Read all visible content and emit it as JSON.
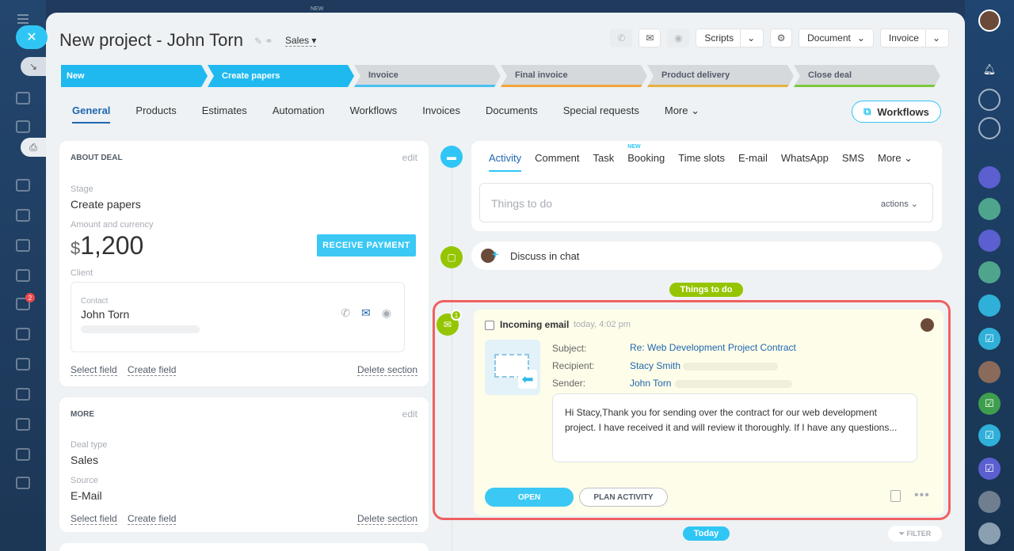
{
  "header": {
    "title": "New project - John Torn",
    "category": "Sales",
    "scripts_label": "Scripts",
    "document_label": "Document",
    "invoice_label": "Invoice"
  },
  "stages": [
    {
      "label": "New",
      "state": "on",
      "color": "#1fb9ef"
    },
    {
      "label": "Create papers",
      "state": "on",
      "color": "#1fb9ef"
    },
    {
      "label": "Invoice",
      "state": "off",
      "color": "#47c1f0"
    },
    {
      "label": "Final invoice",
      "state": "off",
      "color": "#f3a53a"
    },
    {
      "label": "Product delivery",
      "state": "off",
      "color": "#e6b13e"
    },
    {
      "label": "Close deal",
      "state": "off",
      "color": "#7cc83e"
    }
  ],
  "tabs": [
    "General",
    "Products",
    "Estimates",
    "Automation",
    "Workflows",
    "Invoices",
    "Documents",
    "Special requests",
    "More"
  ],
  "workflows_button": "Workflows",
  "about": {
    "heading": "ABOUT DEAL",
    "edit": "edit",
    "stage_label": "Stage",
    "stage_value": "Create papers",
    "amount_label": "Amount and currency",
    "currency": "$",
    "amount": "1,200",
    "pay_button": "RECEIVE PAYMENT",
    "client_label": "Client",
    "contact_label": "Contact",
    "contact_name": "John Torn",
    "select_field": "Select field",
    "create_field": "Create field",
    "delete_section": "Delete section"
  },
  "more": {
    "heading": "MORE",
    "edit": "edit",
    "deal_type_label": "Deal type",
    "deal_type_value": "Sales",
    "source_label": "Source",
    "source_value": "E-Mail",
    "select_field": "Select field",
    "create_field": "Create field",
    "delete_section": "Delete section"
  },
  "activity": {
    "tabs": [
      "Activity",
      "Comment",
      "Task",
      "Booking",
      "Time slots",
      "E-mail",
      "WhatsApp",
      "SMS",
      "More"
    ],
    "new_badge": "NEW",
    "placeholder": "Things to do",
    "actions": "actions"
  },
  "chat": {
    "label": "Discuss in chat"
  },
  "things_pill": "Things to do",
  "email": {
    "badge": "1",
    "title": "Incoming email",
    "time": "today, 4:02 pm",
    "subject_label": "Subject:",
    "subject": "Re: Web Development Project Contract",
    "recipient_label": "Recipient:",
    "recipient": "Stacy Smith",
    "sender_label": "Sender:",
    "sender": "John Torn",
    "body": "Hi Stacy,Thank you for sending over the contract for our web development project. I have received it and will review it thoroughly. If I have any questions...",
    "open_button": "OPEN",
    "plan_button": "PLAN ACTIVITY"
  },
  "today_pill": "Today",
  "filter_label": "FILTER",
  "left_badge": "2",
  "top_new": "NEW"
}
